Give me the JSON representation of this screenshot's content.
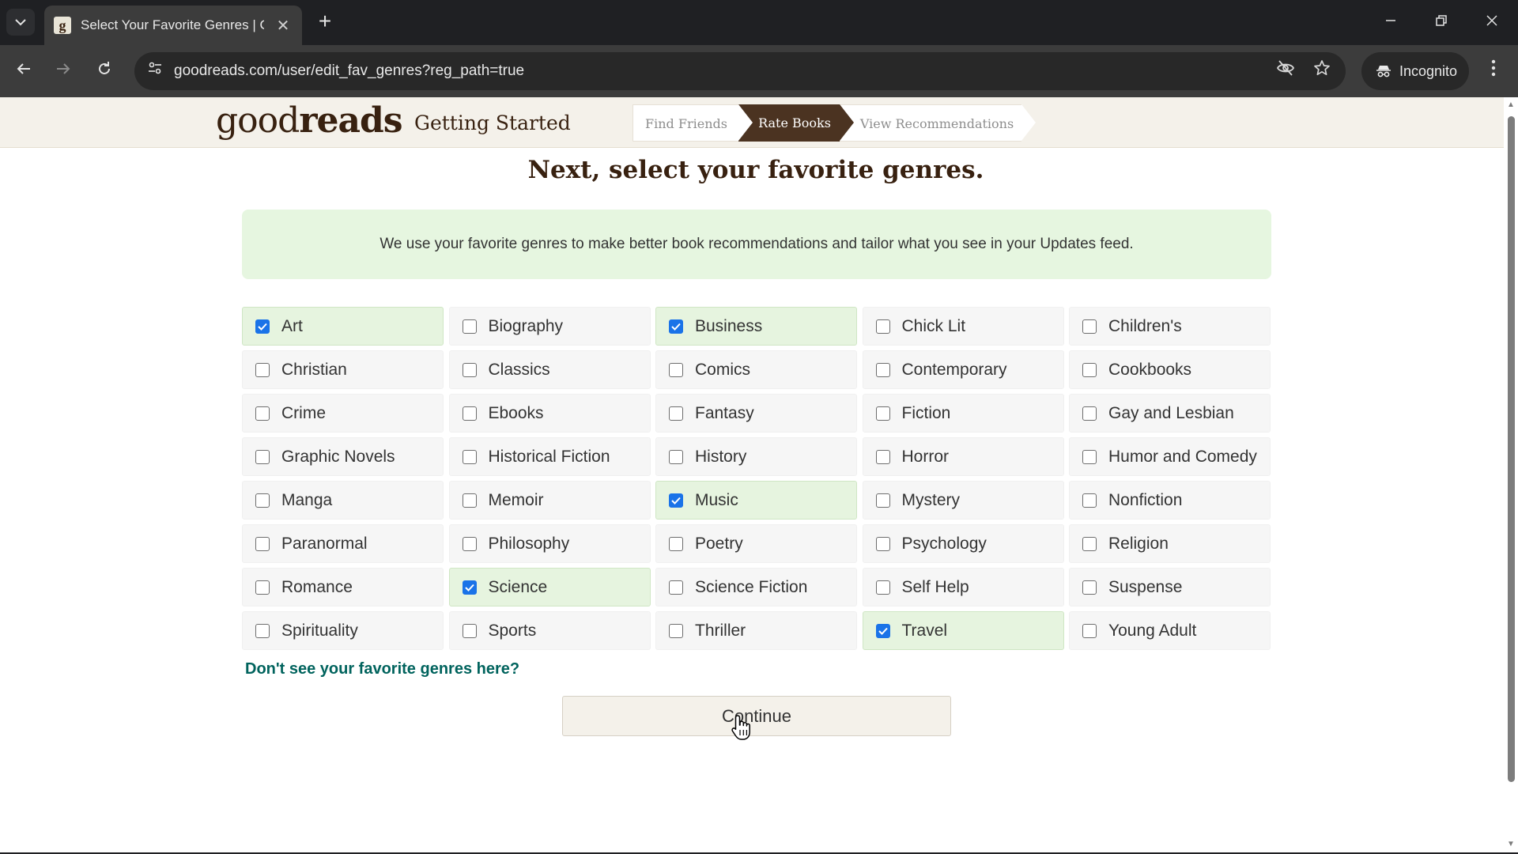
{
  "browser": {
    "tab_title": "Select Your Favorite Genres | Goodreads",
    "tab_favicon_letter": "g",
    "new_tab_label": "+",
    "url": "goodreads.com/user/edit_fav_genres?reg_path=true",
    "incognito_label": "Incognito"
  },
  "header": {
    "logo_good": "good",
    "logo_reads": "reads",
    "title": "Getting Started",
    "steps": [
      {
        "label": "Find Friends",
        "active": false
      },
      {
        "label": "Rate Books",
        "active": true
      },
      {
        "label": "View Recommendations",
        "active": false
      }
    ]
  },
  "main": {
    "heading": "Next, select your favorite genres.",
    "info_text": "We use your favorite genres to make better book recommendations and tailor what you see in your Updates feed.",
    "genres": [
      {
        "label": "Art",
        "checked": true
      },
      {
        "label": "Biography",
        "checked": false
      },
      {
        "label": "Business",
        "checked": true
      },
      {
        "label": "Chick Lit",
        "checked": false
      },
      {
        "label": "Children's",
        "checked": false
      },
      {
        "label": "Christian",
        "checked": false
      },
      {
        "label": "Classics",
        "checked": false
      },
      {
        "label": "Comics",
        "checked": false
      },
      {
        "label": "Contemporary",
        "checked": false
      },
      {
        "label": "Cookbooks",
        "checked": false
      },
      {
        "label": "Crime",
        "checked": false
      },
      {
        "label": "Ebooks",
        "checked": false
      },
      {
        "label": "Fantasy",
        "checked": false
      },
      {
        "label": "Fiction",
        "checked": false
      },
      {
        "label": "Gay and Lesbian",
        "checked": false
      },
      {
        "label": "Graphic Novels",
        "checked": false
      },
      {
        "label": "Historical Fiction",
        "checked": false
      },
      {
        "label": "History",
        "checked": false
      },
      {
        "label": "Horror",
        "checked": false
      },
      {
        "label": "Humor and Comedy",
        "checked": false
      },
      {
        "label": "Manga",
        "checked": false
      },
      {
        "label": "Memoir",
        "checked": false
      },
      {
        "label": "Music",
        "checked": true
      },
      {
        "label": "Mystery",
        "checked": false
      },
      {
        "label": "Nonfiction",
        "checked": false
      },
      {
        "label": "Paranormal",
        "checked": false
      },
      {
        "label": "Philosophy",
        "checked": false
      },
      {
        "label": "Poetry",
        "checked": false
      },
      {
        "label": "Psychology",
        "checked": false
      },
      {
        "label": "Religion",
        "checked": false
      },
      {
        "label": "Romance",
        "checked": false
      },
      {
        "label": "Science",
        "checked": true
      },
      {
        "label": "Science Fiction",
        "checked": false
      },
      {
        "label": "Self Help",
        "checked": false
      },
      {
        "label": "Suspense",
        "checked": false
      },
      {
        "label": "Spirituality",
        "checked": false
      },
      {
        "label": "Sports",
        "checked": false
      },
      {
        "label": "Thriller",
        "checked": false
      },
      {
        "label": "Travel",
        "checked": true
      },
      {
        "label": "Young Adult",
        "checked": false
      }
    ],
    "more_genres_link": "Don't see your favorite genres here?",
    "continue_label": "Continue"
  },
  "colors": {
    "brand_brown": "#382110",
    "active_step": "#4b3321",
    "checked_tile": "#e6f4df",
    "checkbox_blue": "#1a73e8",
    "link_green": "#00635d",
    "info_box": "#e6f6e0"
  },
  "icons": {
    "tab_search": "chevron-down-icon",
    "tab_close": "close-icon",
    "back": "arrow-left-icon",
    "forward": "arrow-right-icon",
    "reload": "reload-icon",
    "site_info": "tune-icon",
    "tracking": "eye-off-icon",
    "bookmark": "star-icon",
    "incognito": "incognito-icon",
    "menu": "kebab-menu-icon",
    "cursor": "hand-pointer-icon"
  }
}
